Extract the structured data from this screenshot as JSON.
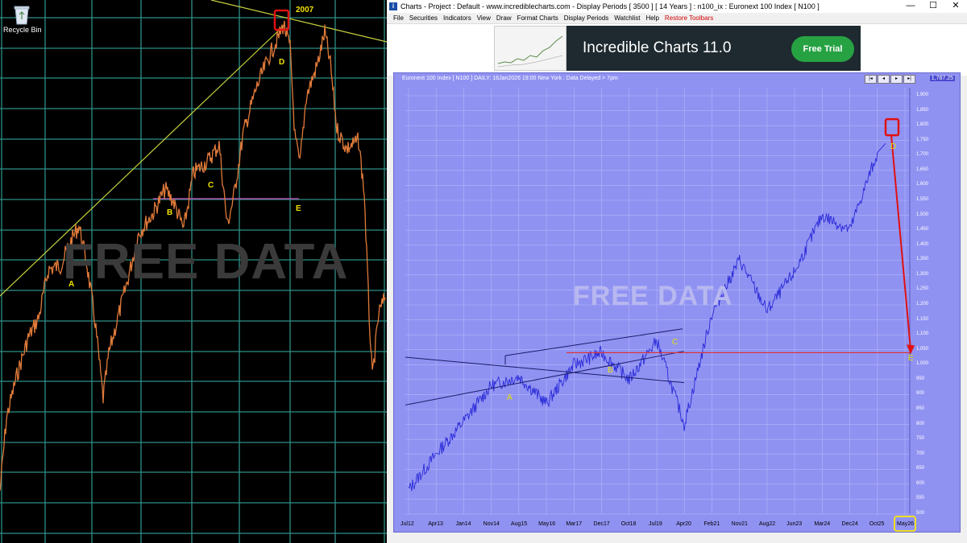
{
  "desktop": {
    "recycle_bin_label": "Recycle Bin",
    "watermark": "FREE DATA",
    "year_label": "2007",
    "wave_labels": [
      "A",
      "B",
      "C",
      "D",
      "E"
    ],
    "colors": {
      "price_line": "#e07a3a",
      "grid": "#2e8f86",
      "trendline": "#c8d23c",
      "support": "#b050b0",
      "marker": "#e01010",
      "labels": "#f2e200"
    }
  },
  "window": {
    "title": "Charts - Project : Default - www.incrediblecharts.com - Display Periods  [ 3500 ]  [ 14 Years ] : n100_ix : Euronext 100 Index  [ N100 ]",
    "controls": {
      "minimize": "—",
      "maximize": "☐",
      "close": "✕"
    },
    "menu": [
      "File",
      "Securities",
      "Indicators",
      "View",
      "Draw",
      "Format Charts",
      "Display Periods",
      "Watchlist",
      "Help"
    ],
    "menu_restore": "Restore Toolbars",
    "ad": {
      "title": "Incredible Charts 11.0",
      "button": "Free Trial"
    }
  },
  "chart": {
    "header": "Euronext 100 Index [ N100 ] DAILY: 16Jan2026 19:00 New York : Data Delayed > 7pm",
    "last_price": "1,787.25",
    "nav_buttons": [
      "|◂",
      "◂",
      "▸",
      "▸|"
    ],
    "watermark": "FREE DATA",
    "wave_labels": [
      "A",
      "B",
      "C",
      "D",
      "E"
    ],
    "colors": {
      "background": "#9092f2",
      "price_line": "#2a2ad8",
      "grid": "#b4b6f8",
      "trendline": "#1a1a6a",
      "target_line": "#e03030",
      "marker": "#e01010",
      "labels": "#e8e000"
    }
  },
  "chart_data": {
    "type": "line",
    "series": [
      {
        "name": "Euronext 100 Index",
        "x": [
          "Jul12",
          "Apr13",
          "Jan14",
          "Nov14",
          "Aug15",
          "May16",
          "Mar17",
          "Dec17",
          "Oct18",
          "Jul19",
          "Apr20",
          "Feb21",
          "Nov21",
          "Aug22",
          "Jun23",
          "Mar24",
          "Dec24",
          "Oct25"
        ],
        "values": [
          580,
          700,
          810,
          930,
          960,
          870,
          1000,
          1040,
          950,
          1080,
          800,
          1170,
          1350,
          1180,
          1310,
          1500,
          1450,
          1710
        ]
      }
    ],
    "x_ticks": [
      "Jul12",
      "Apr13",
      "Jan14",
      "Nov14",
      "Aug15",
      "May16",
      "Mar17",
      "Dec17",
      "Oct18",
      "Jul19",
      "Apr20",
      "Feb21",
      "Nov21",
      "Aug22",
      "Jun23",
      "Mar24",
      "Dec24",
      "Oct25",
      "May26"
    ],
    "y_ticks": [
      "1,900",
      "1,850",
      "1,800",
      "1,750",
      "1,700",
      "1,650",
      "1,600",
      "1,550",
      "1,500",
      "1,450",
      "1,400",
      "1,350",
      "1,300",
      "1,250",
      "1,200",
      "1,150",
      "1,100",
      "1,050",
      "1,000",
      "950",
      "900",
      "850",
      "800",
      "750",
      "700",
      "650",
      "600",
      "550",
      "500"
    ],
    "ylim": [
      500,
      1900
    ],
    "target_level": 1040,
    "grid": true
  }
}
